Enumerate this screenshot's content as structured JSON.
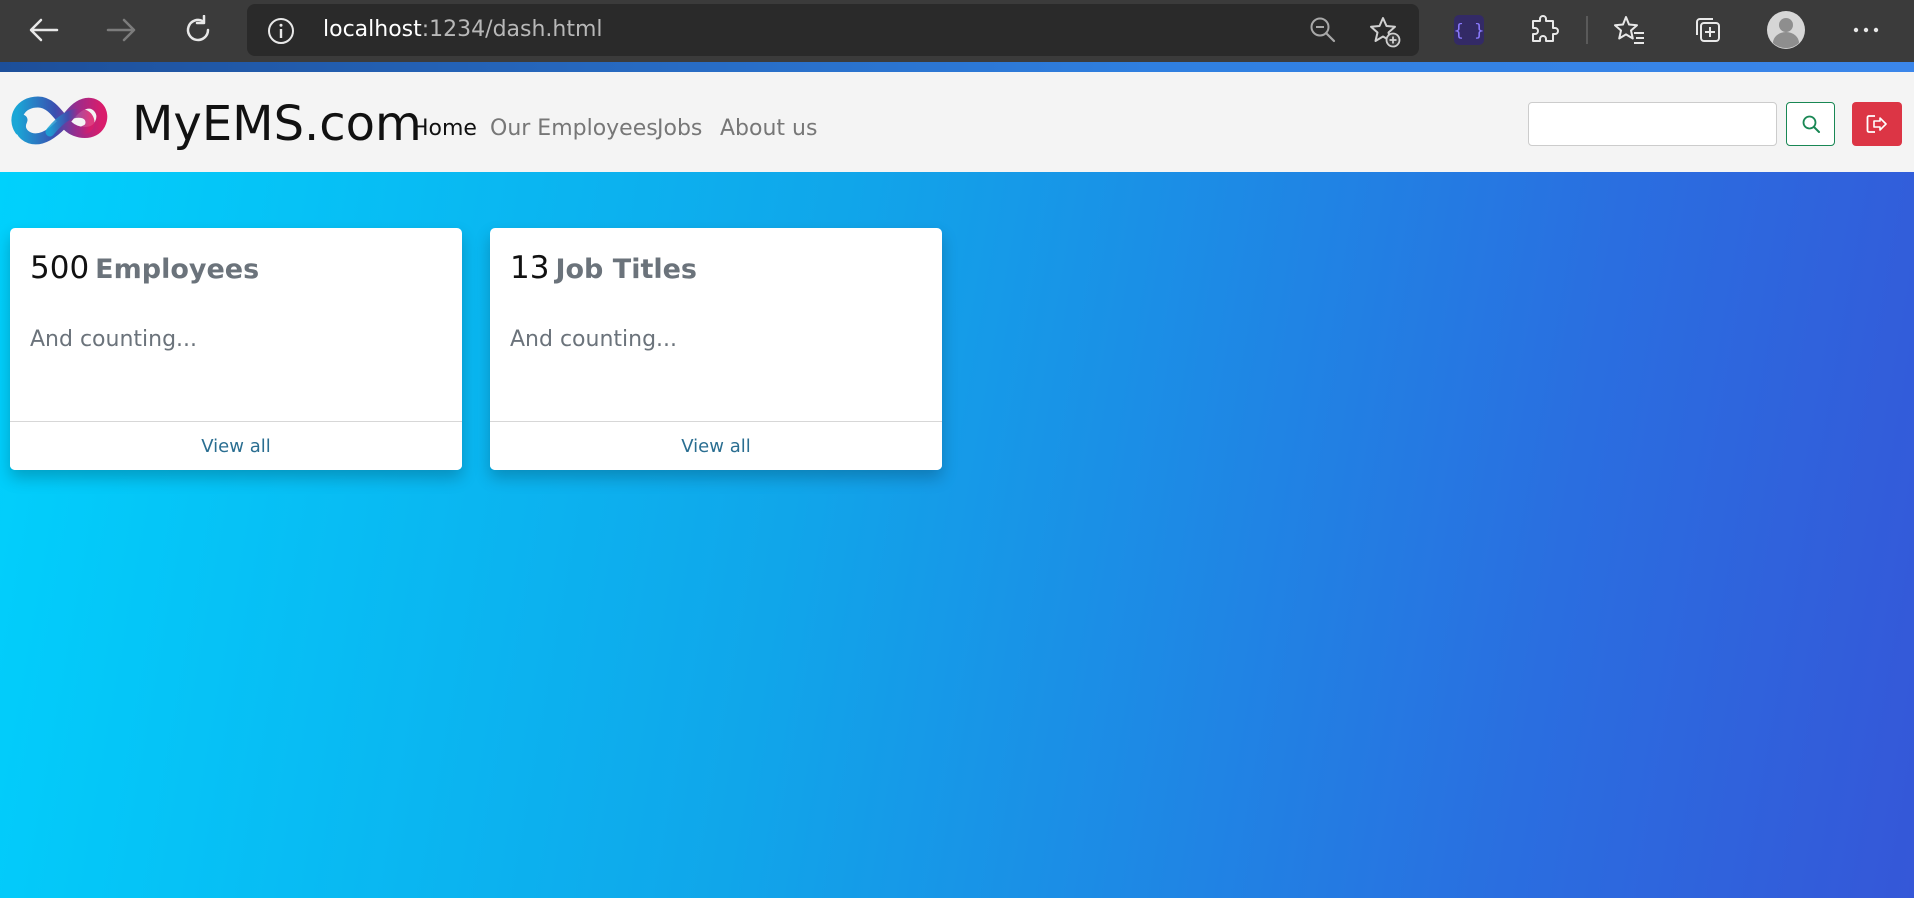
{
  "browser": {
    "url_host": "localhost",
    "url_path": ":1234/dash.html",
    "icons": {
      "back": "back-arrow-icon",
      "forward": "forward-arrow-icon",
      "refresh": "refresh-icon",
      "info": "info-icon",
      "zoom": "zoom-out-icon",
      "favorite_add": "add-favorite-icon",
      "devtools": "devtools-icon",
      "extensions": "extensions-icon",
      "favorites": "favorites-icon",
      "collections": "collections-icon",
      "profile": "profile-avatar-icon",
      "more": "more-icon"
    }
  },
  "navbar": {
    "brand": "MyEMS.com",
    "links": [
      {
        "label": "Home",
        "active": true
      },
      {
        "label": "Our Employees",
        "active": false
      },
      {
        "label": "Jobs",
        "active": false
      },
      {
        "label": "About us",
        "active": false
      }
    ],
    "search": {
      "value": "",
      "placeholder": ""
    }
  },
  "cards": [
    {
      "count": "500",
      "label": "Employees",
      "text": "And counting...",
      "link": "View all"
    },
    {
      "count": "13",
      "label": "Job Titles",
      "text": "And counting...",
      "link": "View all"
    }
  ],
  "colors": {
    "brand_dark": "#111111",
    "link": "#2a6e91",
    "search_button_border": "#198754",
    "logout_button": "#dc3545",
    "gradient_start": "#00d2fd",
    "gradient_end": "#3557d8"
  }
}
